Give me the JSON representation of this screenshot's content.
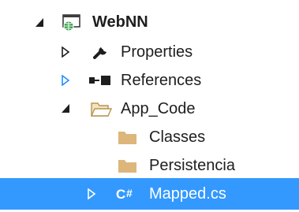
{
  "solution_explorer": {
    "project": {
      "label": "WebNN",
      "icon": "web-project-icon",
      "expanded": true
    },
    "properties": {
      "label": "Properties",
      "icon": "wrench-icon",
      "expanded": false
    },
    "references": {
      "label": "References",
      "icon": "references-icon",
      "expanded": false
    },
    "app_code": {
      "label": "App_Code",
      "icon": "folder-open-icon",
      "expanded": true
    },
    "classes": {
      "label": "Classes",
      "icon": "folder-icon"
    },
    "persistencia": {
      "label": "Persistencia",
      "icon": "folder-icon"
    },
    "mapped": {
      "label": "Mapped.cs",
      "icon": "csharp-file-icon",
      "expanded": false,
      "selected": true
    }
  },
  "colors": {
    "selection": "#3399ff",
    "folder": "#dcb67a",
    "text": "#1e1e1e",
    "expander_blue": "#1e90ff"
  }
}
